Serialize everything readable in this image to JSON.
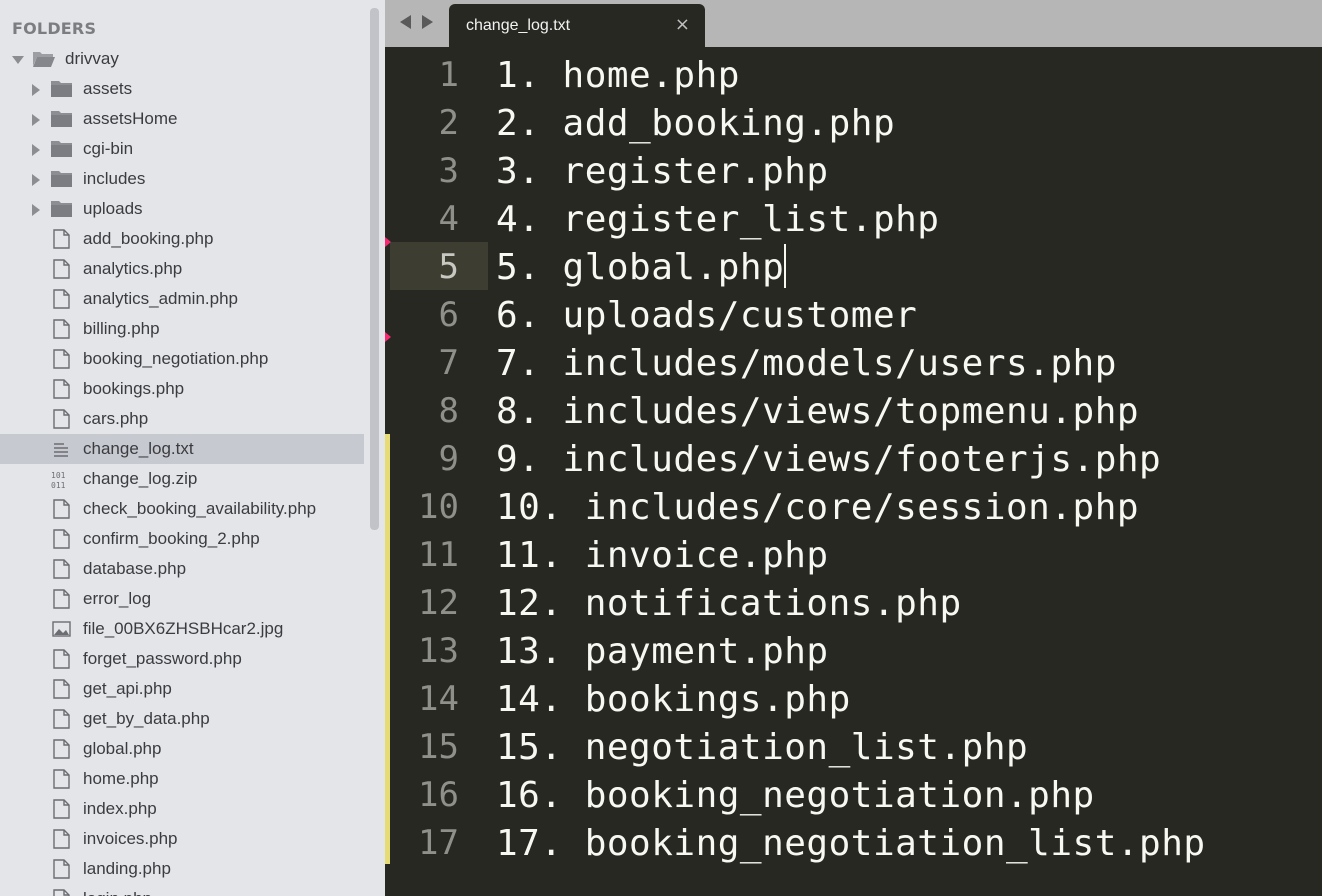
{
  "sidebar": {
    "header": "FOLDERS",
    "root": {
      "name": "drivvay",
      "expanded": true
    },
    "folders": [
      "assets",
      "assetsHome",
      "cgi-bin",
      "includes",
      "uploads"
    ],
    "files": [
      {
        "name": "add_booking.php",
        "icon": "file-icon"
      },
      {
        "name": "analytics.php",
        "icon": "file-icon"
      },
      {
        "name": "analytics_admin.php",
        "icon": "file-icon"
      },
      {
        "name": "billing.php",
        "icon": "file-icon"
      },
      {
        "name": "booking_negotiation.php",
        "icon": "file-icon"
      },
      {
        "name": "bookings.php",
        "icon": "file-icon"
      },
      {
        "name": "cars.php",
        "icon": "file-icon"
      },
      {
        "name": "change_log.txt",
        "icon": "text-file-icon",
        "selected": true
      },
      {
        "name": "change_log.zip",
        "icon": "binary-file-icon"
      },
      {
        "name": "check_booking_availability.php",
        "icon": "file-icon"
      },
      {
        "name": "confirm_booking_2.php",
        "icon": "file-icon"
      },
      {
        "name": "database.php",
        "icon": "file-icon"
      },
      {
        "name": "error_log",
        "icon": "file-icon"
      },
      {
        "name": "file_00BX6ZHSBHcar2.jpg",
        "icon": "image-file-icon"
      },
      {
        "name": "forget_password.php",
        "icon": "file-icon"
      },
      {
        "name": "get_api.php",
        "icon": "file-icon"
      },
      {
        "name": "get_by_data.php",
        "icon": "file-icon"
      },
      {
        "name": "global.php",
        "icon": "file-icon"
      },
      {
        "name": "home.php",
        "icon": "file-icon"
      },
      {
        "name": "index.php",
        "icon": "file-icon"
      },
      {
        "name": "invoices.php",
        "icon": "file-icon"
      },
      {
        "name": "landing.php",
        "icon": "file-icon"
      },
      {
        "name": "login.php",
        "icon": "file-icon"
      }
    ]
  },
  "tabbar": {
    "active_tab": "change_log.txt",
    "close_glyph": "×"
  },
  "editor": {
    "current_line": 5,
    "lines": [
      {
        "num": "1",
        "text": "1. home.php"
      },
      {
        "num": "2",
        "text": "2. add_booking.php"
      },
      {
        "num": "3",
        "text": "3. register.php"
      },
      {
        "num": "4",
        "text": "4. register_list.php"
      },
      {
        "num": "5",
        "text": "5. global.php"
      },
      {
        "num": "6",
        "text": "6. uploads/customer"
      },
      {
        "num": "7",
        "text": "7. includes/models/users.php"
      },
      {
        "num": "8",
        "text": "8. includes/views/topmenu.php"
      },
      {
        "num": "9",
        "text": "9. includes/views/footerjs.php"
      },
      {
        "num": "10",
        "text": "10. includes/core/session.php"
      },
      {
        "num": "11",
        "text": "11. invoice.php"
      },
      {
        "num": "12",
        "text": "12. notifications.php"
      },
      {
        "num": "13",
        "text": "13. payment.php"
      },
      {
        "num": "14",
        "text": "14. bookings.php"
      },
      {
        "num": "15",
        "text": "15. negotiation_list.php"
      },
      {
        "num": "16",
        "text": "16. booking_negotiation.php"
      },
      {
        "num": "17",
        "text": "17. booking_negotiation_list.php"
      }
    ]
  },
  "colors": {
    "editor_bg": "#272822",
    "sidebar_bg": "#e4e5e9",
    "selection_bg": "#c7c9d0",
    "modified_marker": "#e6db74",
    "deleted_marker": "#f92672"
  }
}
